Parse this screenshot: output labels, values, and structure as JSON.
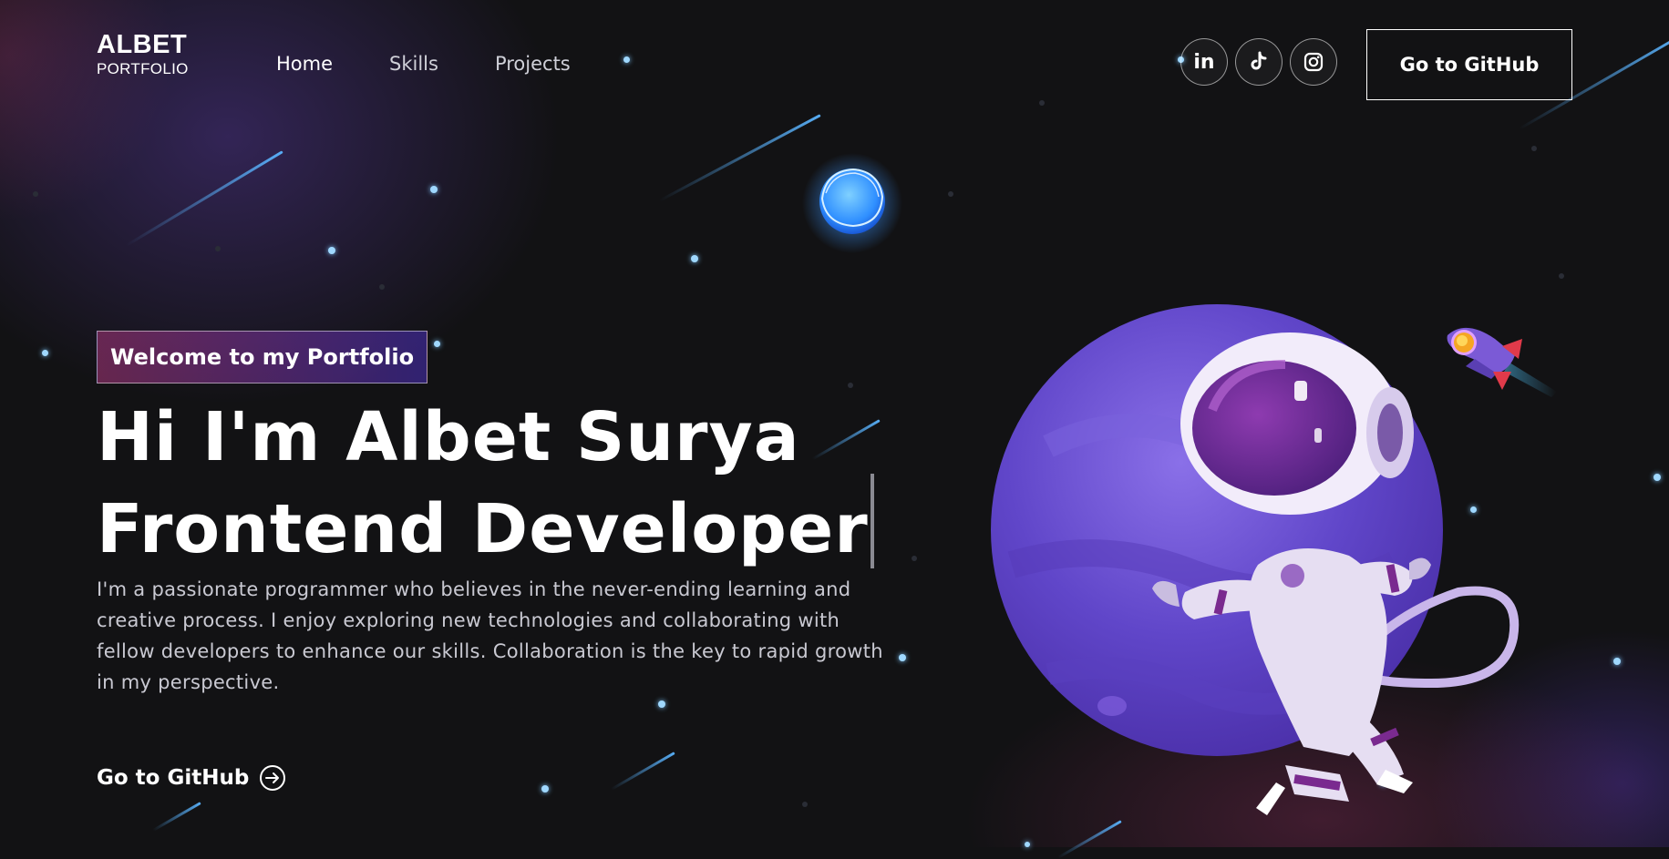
{
  "header": {
    "logo_main": "ALBET",
    "logo_sub": "PORTFOLIO",
    "nav": [
      {
        "label": "Home"
      },
      {
        "label": "Skills"
      },
      {
        "label": "Projects"
      }
    ],
    "socials": [
      {
        "icon": "linkedin-icon",
        "label": "in"
      },
      {
        "icon": "tiktok-icon"
      },
      {
        "icon": "instagram-icon"
      }
    ],
    "github_button": "Go to GitHub"
  },
  "hero": {
    "badge": "Welcome to my Portfolio",
    "title_line1": "Hi I'm Albet Surya",
    "title_line2": "Frontend Developer",
    "intro": "I'm a passionate programmer who believes in the never-ending learning and creative process. I enjoy exploring new technologies and collaborating with fellow developers to enhance our skills. Collaboration is the key to rapid growth in my perspective.",
    "cta": "Go to GitHub"
  },
  "colors": {
    "background": "#121214",
    "badge_gradient_start": "#aa367c",
    "badge_gradient_end": "#4a2fbd",
    "planet": "#6b4fd1",
    "star": "#9fd8ff"
  }
}
